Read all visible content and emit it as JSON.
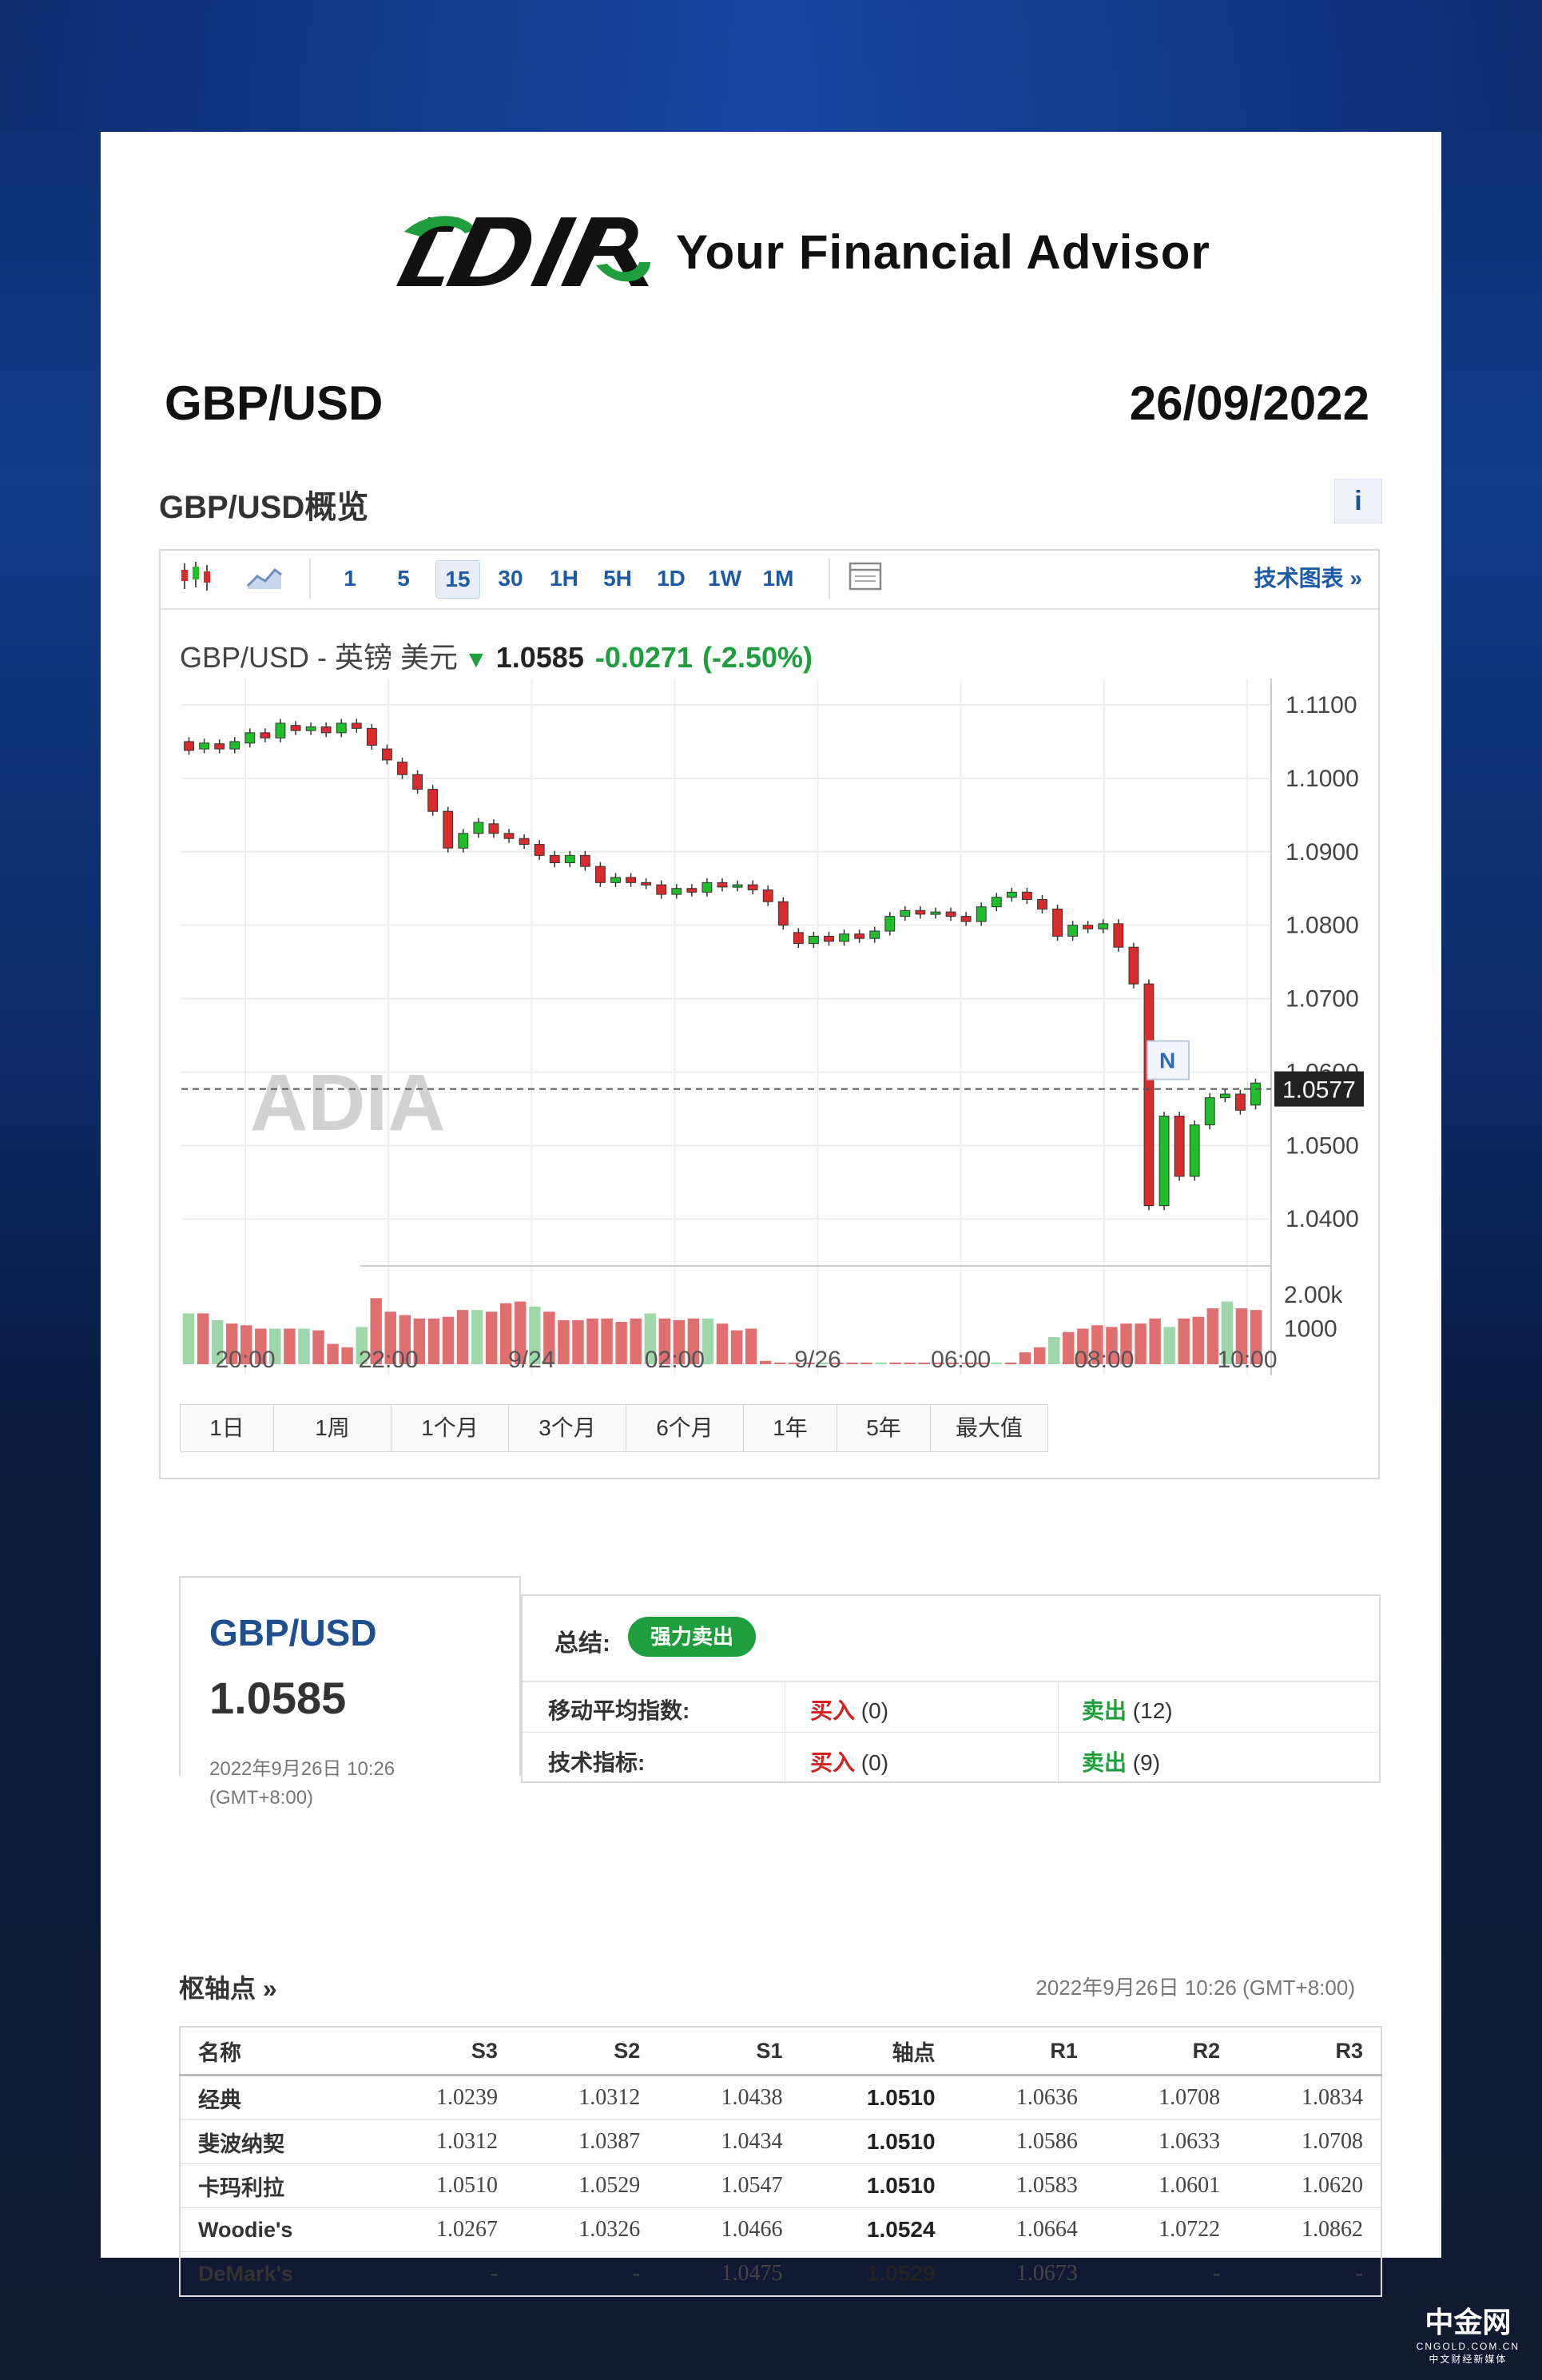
{
  "header": {
    "tagline": "Your Financial Advisor",
    "pair": "GBP/USD",
    "date": "26/09/2022"
  },
  "overview": {
    "title": "GBP/USD概览",
    "info": "i"
  },
  "toolbar": {
    "intervals": [
      "1",
      "5",
      "15",
      "30",
      "1H",
      "5H",
      "1D",
      "1W",
      "1M"
    ],
    "selected": "15",
    "tech_link": "技术图表 »"
  },
  "quote": {
    "name": "GBP/USD - 英镑 美元",
    "price": "1.0585",
    "change": "-0.0271",
    "change_pct": "(-2.50%)"
  },
  "chart_data": {
    "type": "candlestick",
    "y_ticks": [
      "1.1100",
      "1.1000",
      "1.0900",
      "1.0800",
      "1.0700",
      "1.0600",
      "1.0500",
      "1.0400"
    ],
    "ylim": [
      1.0385,
      1.1125
    ],
    "x_ticks": [
      "20:00",
      "22:00",
      "9/24",
      "02:00",
      "9/26",
      "06:00",
      "08:00",
      "10:00"
    ],
    "last_price_label": "1.0577",
    "last_price": 1.0577,
    "marker": "N",
    "watermark": "ADIA",
    "volume_ticks": [
      "2.00k",
      "1000"
    ],
    "volume_ylim": [
      0,
      2500
    ],
    "candles": [
      [
        1.105,
        1.1038
      ],
      [
        1.104,
        1.1048
      ],
      [
        1.1047,
        1.104
      ],
      [
        1.104,
        1.105
      ],
      [
        1.1048,
        1.1062
      ],
      [
        1.1062,
        1.1055
      ],
      [
        1.1055,
        1.1075
      ],
      [
        1.1072,
        1.1065
      ],
      [
        1.1065,
        1.107
      ],
      [
        1.107,
        1.1062
      ],
      [
        1.1062,
        1.1075
      ],
      [
        1.1075,
        1.1068
      ],
      [
        1.1068,
        1.1045
      ],
      [
        1.104,
        1.1025
      ],
      [
        1.1022,
        1.1005
      ],
      [
        1.1005,
        1.0985
      ],
      [
        1.0985,
        1.0955
      ],
      [
        1.0955,
        1.0905
      ],
      [
        1.0905,
        1.0925
      ],
      [
        1.0925,
        1.094
      ],
      [
        1.0938,
        1.0925
      ],
      [
        1.0925,
        1.0918
      ],
      [
        1.0918,
        1.091
      ],
      [
        1.091,
        1.0895
      ],
      [
        1.0895,
        1.0885
      ],
      [
        1.0885,
        1.0895
      ],
      [
        1.0895,
        1.088
      ],
      [
        1.088,
        1.0858
      ],
      [
        1.0858,
        1.0865
      ],
      [
        1.0865,
        1.0858
      ],
      [
        1.0858,
        1.0855
      ],
      [
        1.0855,
        1.0842
      ],
      [
        1.0842,
        1.085
      ],
      [
        1.085,
        1.0845
      ],
      [
        1.0845,
        1.0858
      ],
      [
        1.0858,
        1.0852
      ],
      [
        1.0852,
        1.0855
      ],
      [
        1.0855,
        1.0848
      ],
      [
        1.0848,
        1.0832
      ],
      [
        1.0832,
        1.08
      ],
      [
        1.079,
        1.0775
      ],
      [
        1.0775,
        1.0785
      ],
      [
        1.0785,
        1.0778
      ],
      [
        1.0778,
        1.0788
      ],
      [
        1.0788,
        1.0782
      ],
      [
        1.0782,
        1.0792
      ],
      [
        1.0792,
        1.0812
      ],
      [
        1.0812,
        1.082
      ],
      [
        1.082,
        1.0815
      ],
      [
        1.0815,
        1.0818
      ],
      [
        1.0818,
        1.0812
      ],
      [
        1.0812,
        1.0805
      ],
      [
        1.0805,
        1.0825
      ],
      [
        1.0825,
        1.0838
      ],
      [
        1.0838,
        1.0845
      ],
      [
        1.0845,
        1.0835
      ],
      [
        1.0835,
        1.0822
      ],
      [
        1.0822,
        1.0785
      ],
      [
        1.0785,
        1.08
      ],
      [
        1.08,
        1.0795
      ],
      [
        1.0795,
        1.0802
      ],
      [
        1.0802,
        1.077
      ],
      [
        1.077,
        1.072
      ],
      [
        1.072,
        1.0418
      ],
      [
        1.0418,
        1.054
      ],
      [
        1.054,
        1.0458
      ],
      [
        1.0458,
        1.0528
      ],
      [
        1.0528,
        1.0565
      ],
      [
        1.0565,
        1.057
      ],
      [
        1.057,
        1.0548
      ],
      [
        1.0555,
        1.0585
      ]
    ],
    "volumes": [
      1500,
      1500,
      1300,
      1200,
      1150,
      1050,
      1050,
      1050,
      1050,
      1000,
      600,
      500,
      1100,
      1950,
      1550,
      1450,
      1350,
      1350,
      1400,
      1600,
      1600,
      1550,
      1800,
      1850,
      1700,
      1550,
      1300,
      1300,
      1350,
      1350,
      1250,
      1350,
      1500,
      1350,
      1300,
      1350,
      1350,
      1200,
      1000,
      1050,
      100,
      50,
      50,
      50,
      50,
      50,
      50,
      50,
      50,
      50,
      50,
      50,
      50,
      50,
      50,
      50,
      50,
      50,
      350,
      500,
      800,
      950,
      1050,
      1150,
      1100,
      1200,
      1200,
      1350,
      1100,
      1350,
      1400,
      1650,
      1850,
      1650,
      1600
    ]
  },
  "ranges": [
    "1日",
    "1周",
    "1个月",
    "3个月",
    "6个月",
    "1年",
    "5年",
    "最大值"
  ],
  "summary": {
    "pair": "GBP/USD",
    "price": "1.0585",
    "time": "2022年9月26日 10:26 (GMT+8:00)",
    "label": "总结:",
    "badge": "强力卖出",
    "ma_label": "移动平均指数:",
    "ma_buy": "买入",
    "ma_buy_count": "(0)",
    "ma_sell": "卖出",
    "ma_sell_count": "(12)",
    "ti_label": "技术指标:",
    "ti_buy": "买入",
    "ti_buy_count": "(0)",
    "ti_sell": "卖出",
    "ti_sell_count": "(9)"
  },
  "pivots": {
    "title": "枢轴点 »",
    "time": "2022年9月26日 10:26 (GMT+8:00)",
    "headers": [
      "名称",
      "S3",
      "S2",
      "S1",
      "轴点",
      "R1",
      "R2",
      "R3"
    ],
    "rows": [
      [
        "经典",
        "1.0239",
        "1.0312",
        "1.0438",
        "1.0510",
        "1.0636",
        "1.0708",
        "1.0834"
      ],
      [
        "斐波纳契",
        "1.0312",
        "1.0387",
        "1.0434",
        "1.0510",
        "1.0586",
        "1.0633",
        "1.0708"
      ],
      [
        "卡玛利拉",
        "1.0510",
        "1.0529",
        "1.0547",
        "1.0510",
        "1.0583",
        "1.0601",
        "1.0620"
      ],
      [
        "Woodie's",
        "1.0267",
        "1.0326",
        "1.0466",
        "1.0524",
        "1.0664",
        "1.0722",
        "1.0862"
      ],
      [
        "DeMark's",
        "-",
        "-",
        "1.0475",
        "1.0529",
        "1.0673",
        "-",
        "-"
      ]
    ]
  },
  "footer_brand": {
    "name": "中金网",
    "sub": "CNGOLD.COM.CN",
    "sub2": "中文财经新媒体"
  },
  "colors": {
    "up": "#1fbf2a",
    "down": "#d92b2b",
    "vol_up": "#9fd8a8",
    "vol_down": "#e07070",
    "accent": "#1d4f91"
  }
}
